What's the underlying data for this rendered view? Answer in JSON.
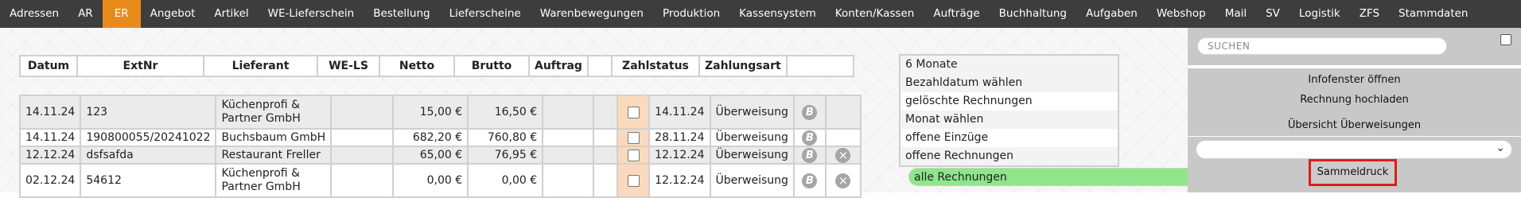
{
  "nav": {
    "items": [
      "Adressen",
      "AR",
      "ER",
      "Angebot",
      "Artikel",
      "WE-Lieferschein",
      "Bestellung",
      "Lieferscheine",
      "Warenbewegungen",
      "Produktion",
      "Kassensystem",
      "Konten/Kassen",
      "Aufträge",
      "Buchhaltung",
      "Aufgaben",
      "Webshop",
      "Mail",
      "SV",
      "Logistik",
      "ZFS",
      "Stammdaten"
    ],
    "active": "ER"
  },
  "table": {
    "headers": [
      "Datum",
      "ExtNr",
      "Lieferant",
      "WE-LS",
      "Netto",
      "Brutto",
      "Auftrag",
      "",
      "Zahlstatus",
      "Zahlungsart",
      ""
    ],
    "rows": [
      {
        "datum": "14.11.24",
        "extnr": "123",
        "lieferant": "Küchenprofi & Partner GmbH",
        "wels": "",
        "netto": "15,00 €",
        "brutto": "16,50 €",
        "auftrag": "",
        "zahldatum": "14.11.24",
        "zahlungsart": "Überweisung",
        "b_icon": "B",
        "delete": false
      },
      {
        "datum": "14.11.24",
        "extnr": "190800055/20241022",
        "lieferant": "Buchsbaum GmbH",
        "wels": "",
        "netto": "682,20 €",
        "brutto": "760,80 €",
        "auftrag": "",
        "zahldatum": "28.11.24",
        "zahlungsart": "Überweisung",
        "b_icon": "B",
        "delete": false
      },
      {
        "datum": "12.12.24",
        "extnr": "dsfsafda",
        "lieferant": "Restaurant Freller",
        "wels": "",
        "netto": "65,00 €",
        "brutto": "76,95 €",
        "auftrag": "",
        "zahldatum": "12.12.24",
        "zahlungsart": "Überweisung",
        "b_icon": "B",
        "delete": true
      },
      {
        "datum": "02.12.24",
        "extnr": "54612",
        "lieferant": "Küchenprofi & Partner GmbH",
        "wels": "",
        "netto": "0,00 €",
        "brutto": "0,00 €",
        "auftrag": "",
        "zahldatum": "12.12.24",
        "zahlungsart": "Überweisung",
        "b_icon": "B",
        "delete": true
      }
    ],
    "delete_glyph": "×"
  },
  "filter": {
    "items": [
      "6 Monate",
      "alle Rechnungen",
      "Bezahldatum wählen",
      "gelöschte Rechnungen",
      "Monat wählen",
      "offene Einzüge",
      "offene Rechnungen"
    ],
    "selected": "alle Rechnungen"
  },
  "right": {
    "search_placeholder": "SUCHEN",
    "info_label": "Infofenster öffnen",
    "upload_label": "Rechnung hochladen",
    "transfers_label": "Übersicht Überweisungen",
    "select_value": "",
    "select_chevron": "⌄",
    "sammel_label": "Sammeldruck"
  },
  "colors": {
    "nav_bg": "#3d3d3d",
    "nav_active": "#e98b1b",
    "filter_selected": "#8ee58a",
    "checkbox_col": "#fbd9bd",
    "highlight_border": "#dd1c1c"
  }
}
